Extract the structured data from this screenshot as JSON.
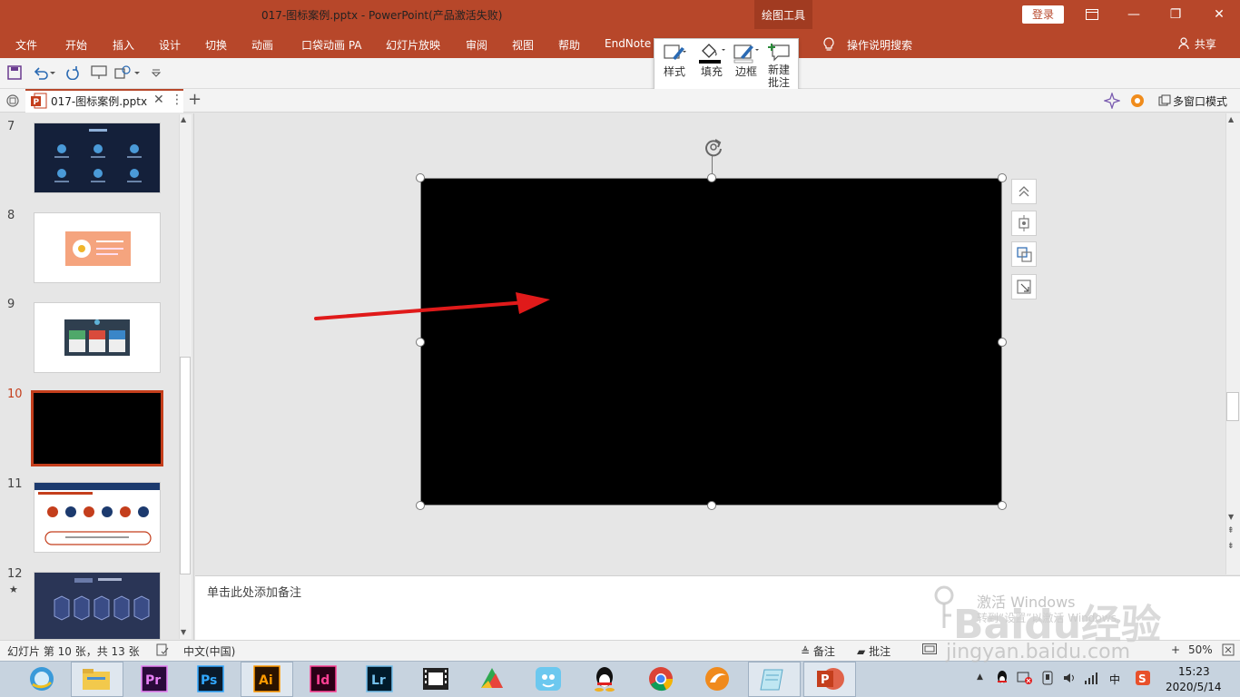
{
  "window": {
    "title": "017-图标案例.pptx  -  PowerPoint(产品激活失败)",
    "context_tab": "绘图工具",
    "login": "登录",
    "min": "—",
    "restore": "❐",
    "close": "✕"
  },
  "ribbon": {
    "tabs": [
      "文件",
      "开始",
      "插入",
      "设计",
      "切换",
      "动画",
      "口袋动画 PA",
      "幻灯片放映",
      "审阅",
      "视图",
      "帮助",
      "EndNote"
    ],
    "tell_me": "操作说明搜索",
    "share": "共享"
  },
  "draw_popup": {
    "style": "样式",
    "fill": "填充",
    "border": "边框",
    "comment_1": "新建",
    "comment_2": "批注"
  },
  "doc_tab": {
    "name": "017-图标案例.pptx",
    "multi_window": "多窗口模式"
  },
  "thumbnails": {
    "items": [
      {
        "num": "7"
      },
      {
        "num": "8"
      },
      {
        "num": "9"
      },
      {
        "num": "10"
      },
      {
        "num": "11"
      },
      {
        "num": "12",
        "star": "★"
      }
    ]
  },
  "notes": {
    "placeholder": "单击此处添加备注",
    "activate": "激活 Windows",
    "activate_sub": "转到“设置”以激活 Windows。"
  },
  "status": {
    "slide_info": "幻灯片 第 10 张，共 13 张",
    "language": "中文(中国)",
    "notes_btn": "备注",
    "comments_btn": "批注",
    "zoom": "50%"
  },
  "taskbar": {
    "time": "15:23",
    "date": "2020/5/14",
    "ime": "中"
  },
  "watermark": {
    "brand": "Baidu经验",
    "url": "jingyan.baidu.com"
  },
  "colors": {
    "accent": "#b7472a",
    "arrow": "#e01a1a"
  }
}
